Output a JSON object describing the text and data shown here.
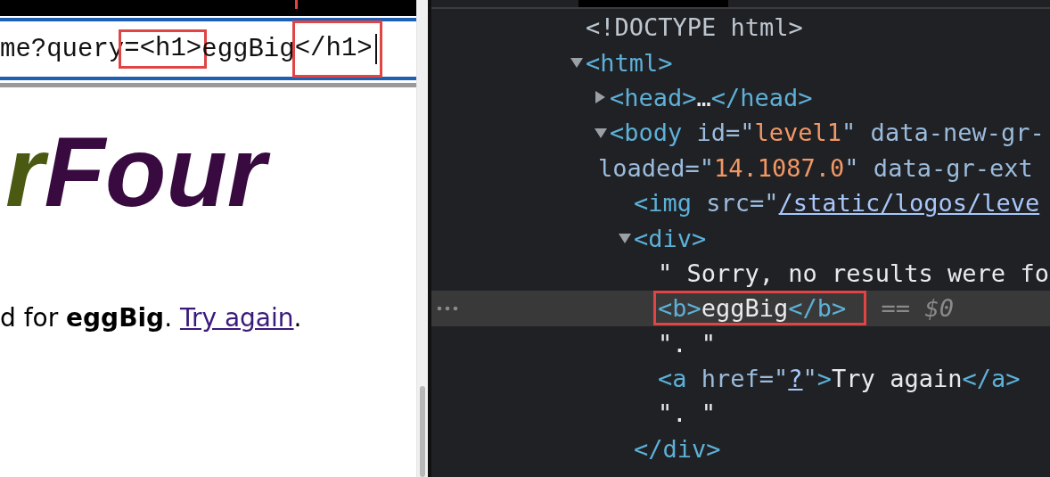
{
  "browser": {
    "url_segments": [
      {
        "text": "me?query",
        "annotated": false
      },
      {
        "text": "=<h1>",
        "annotated": true
      },
      {
        "text": "eggBig",
        "annotated": false
      },
      {
        "text": "</h1>",
        "annotated": true
      }
    ],
    "page": {
      "logo": [
        {
          "text": "r",
          "color": "#4b5a12"
        },
        {
          "text": "Four",
          "color": "#380a40"
        }
      ],
      "message": "d for **eggBig**. ",
      "link": "Try again",
      "message_end": "."
    }
  },
  "devtools": {
    "nodes": [
      {
        "selected": false,
        "lines": [
          {
            "annotated": false,
            "tokens": [
              {
                "kind": "doctype",
                "text": "<!DOCTYPE html>"
              }
            ]
          }
        ]
      },
      {
        "selected": false,
        "expanded": true,
        "lines": [
          {
            "annotated": false,
            "tokens": [
              {
                "kind": "tag",
                "text": "<html>"
              }
            ]
          }
        ],
        "children": [
          {
            "selected": false,
            "expanded": false,
            "lines": [
              {
                "annotated": false,
                "tokens": [
                  {
                    "kind": "tag",
                    "text": "<head>"
                  },
                  {
                    "kind": "ellipsis",
                    "text": "…"
                  },
                  {
                    "kind": "tag",
                    "text": "</head>"
                  }
                ]
              }
            ]
          },
          {
            "selected": false,
            "expanded": true,
            "lines": [
              {
                "annotated": false,
                "tokens": [
                  {
                    "kind": "tag",
                    "text": "<body"
                  },
                  {
                    "kind": "attr",
                    "text": " id=\""
                  },
                  {
                    "kind": "value",
                    "text": "level1"
                  },
                  {
                    "kind": "attr",
                    "text": "\" data-new-gr-"
                  }
                ]
              },
              {
                "annotated": false,
                "tokens": [
                  {
                    "kind": "attr",
                    "text": "loaded=\""
                  },
                  {
                    "kind": "value",
                    "text": "14.1087.0"
                  },
                  {
                    "kind": "attr",
                    "text": "\" data-gr-ext"
                  }
                ]
              }
            ],
            "children": [
              {
                "selected": false,
                "lines": [
                  {
                    "annotated": false,
                    "tokens": [
                      {
                        "kind": "tag",
                        "text": "<img"
                      },
                      {
                        "kind": "attr",
                        "text": " src=\""
                      },
                      {
                        "kind": "link",
                        "text": "/static/logos/leve"
                      }
                    ]
                  }
                ]
              },
              {
                "selected": false,
                "expanded": true,
                "lines": [
                  {
                    "annotated": false,
                    "tokens": [
                      {
                        "kind": "tag",
                        "text": "<div>"
                      }
                    ]
                  }
                ],
                "closing": [
                  {
                    "kind": "tag",
                    "text": "</div>"
                  }
                ],
                "children": [
                  {
                    "selected": false,
                    "lines": [
                      {
                        "annotated": false,
                        "tokens": [
                          {
                            "kind": "text",
                            "text": "\" Sorry, no results were fo"
                          }
                        ]
                      }
                    ]
                  },
                  {
                    "selected": true,
                    "lines": [
                      {
                        "annotated": true,
                        "tokens": [
                          {
                            "kind": "tag",
                            "text": "<b>"
                          },
                          {
                            "kind": "text",
                            "text": "eggBig"
                          },
                          {
                            "kind": "tag",
                            "text": "</b>"
                          }
                        ],
                        "after": [
                          {
                            "kind": "ref",
                            "text": " == $0"
                          }
                        ]
                      }
                    ]
                  },
                  {
                    "selected": false,
                    "lines": [
                      {
                        "annotated": false,
                        "tokens": [
                          {
                            "kind": "text",
                            "text": "\". \""
                          }
                        ]
                      }
                    ]
                  },
                  {
                    "selected": false,
                    "lines": [
                      {
                        "annotated": false,
                        "tokens": [
                          {
                            "kind": "tag",
                            "text": "<a"
                          },
                          {
                            "kind": "attr",
                            "text": " href=\""
                          },
                          {
                            "kind": "link",
                            "text": "?"
                          },
                          {
                            "kind": "attr",
                            "text": "\""
                          },
                          {
                            "kind": "tag",
                            "text": ">"
                          },
                          {
                            "kind": "text",
                            "text": "Try again"
                          },
                          {
                            "kind": "tag",
                            "text": "</a>"
                          }
                        ]
                      }
                    ]
                  },
                  {
                    "selected": false,
                    "lines": [
                      {
                        "annotated": false,
                        "tokens": [
                          {
                            "kind": "text",
                            "text": "\". \""
                          }
                        ]
                      }
                    ]
                  }
                ]
              }
            ]
          }
        ]
      }
    ]
  }
}
